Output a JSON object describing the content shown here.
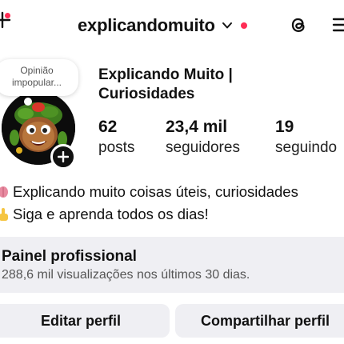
{
  "header": {
    "username": "explicandomuito",
    "icons": [
      "add-icon",
      "chevron-down-icon",
      "notification-dot",
      "threads-icon",
      "menu-icon"
    ]
  },
  "profile": {
    "note_line1": "Opinião",
    "note_line2": "impopular...",
    "display_name_line1": "Explicando Muito |",
    "display_name_line2": "Curiosidades",
    "stats": {
      "posts_count": "62",
      "posts_label": "posts",
      "followers_count": "23,4 mil",
      "followers_label": "seguidores",
      "following_count": "19",
      "following_label": "seguindo"
    },
    "bio_line1": "Explicando muito coisas úteis, curiosidades",
    "bio_line2": "Siga e aprenda todos os dias!"
  },
  "dashboard": {
    "title": "Painel profissional",
    "subtitle": "288,6 mil visualizações nos últimos 30 dias."
  },
  "actions": {
    "edit_label": "Editar perfil",
    "share_label": "Compartilhar perfil"
  },
  "colors": {
    "accent_red": "#ff2d55",
    "button_bg": "#efeff3"
  }
}
